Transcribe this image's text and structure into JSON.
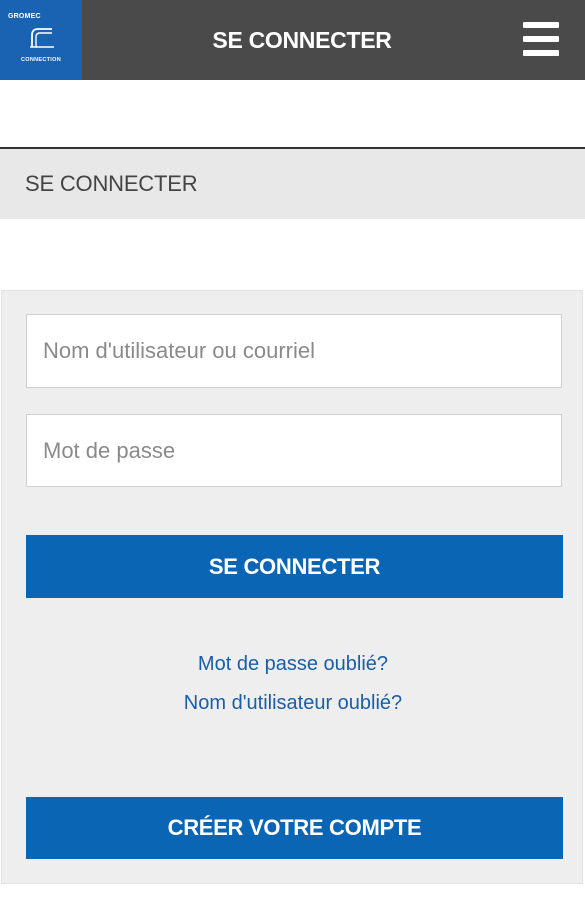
{
  "header": {
    "logo": {
      "brand": "GROMEC",
      "subtitle": "CONNECTION",
      "color": "#1a63b3"
    },
    "title": "SE CONNECTER",
    "menu_icon": "hamburger-menu-icon",
    "bg_color": "#4a4a4a"
  },
  "section": {
    "title": "SE CONNECTER"
  },
  "form": {
    "username": {
      "placeholder": "Nom d'utilisateur ou courriel",
      "value": ""
    },
    "password": {
      "placeholder": "Mot de passe",
      "value": ""
    },
    "submit_label": "SE CONNECTER",
    "links": {
      "forgot_password": "Mot de passe oublié?",
      "forgot_username": "Nom d'utilisateur oublié?"
    },
    "create_account_label": "CRÉER VOTRE COMPTE",
    "button_color": "#0a65b5",
    "link_color": "#1a5ea8"
  }
}
